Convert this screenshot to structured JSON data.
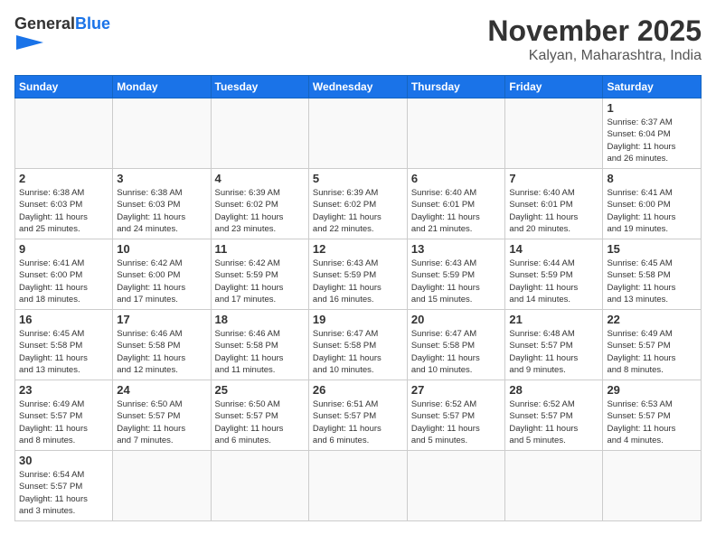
{
  "logo": {
    "text_general": "General",
    "text_blue": "Blue"
  },
  "title": "November 2025",
  "location": "Kalyan, Maharashtra, India",
  "days_of_week": [
    "Sunday",
    "Monday",
    "Tuesday",
    "Wednesday",
    "Thursday",
    "Friday",
    "Saturday"
  ],
  "weeks": [
    [
      {
        "day": "",
        "info": ""
      },
      {
        "day": "",
        "info": ""
      },
      {
        "day": "",
        "info": ""
      },
      {
        "day": "",
        "info": ""
      },
      {
        "day": "",
        "info": ""
      },
      {
        "day": "",
        "info": ""
      },
      {
        "day": "1",
        "info": "Sunrise: 6:37 AM\nSunset: 6:04 PM\nDaylight: 11 hours\nand 26 minutes."
      }
    ],
    [
      {
        "day": "2",
        "info": "Sunrise: 6:38 AM\nSunset: 6:03 PM\nDaylight: 11 hours\nand 25 minutes."
      },
      {
        "day": "3",
        "info": "Sunrise: 6:38 AM\nSunset: 6:03 PM\nDaylight: 11 hours\nand 24 minutes."
      },
      {
        "day": "4",
        "info": "Sunrise: 6:39 AM\nSunset: 6:02 PM\nDaylight: 11 hours\nand 23 minutes."
      },
      {
        "day": "5",
        "info": "Sunrise: 6:39 AM\nSunset: 6:02 PM\nDaylight: 11 hours\nand 22 minutes."
      },
      {
        "day": "6",
        "info": "Sunrise: 6:40 AM\nSunset: 6:01 PM\nDaylight: 11 hours\nand 21 minutes."
      },
      {
        "day": "7",
        "info": "Sunrise: 6:40 AM\nSunset: 6:01 PM\nDaylight: 11 hours\nand 20 minutes."
      },
      {
        "day": "8",
        "info": "Sunrise: 6:41 AM\nSunset: 6:00 PM\nDaylight: 11 hours\nand 19 minutes."
      }
    ],
    [
      {
        "day": "9",
        "info": "Sunrise: 6:41 AM\nSunset: 6:00 PM\nDaylight: 11 hours\nand 18 minutes."
      },
      {
        "day": "10",
        "info": "Sunrise: 6:42 AM\nSunset: 6:00 PM\nDaylight: 11 hours\nand 17 minutes."
      },
      {
        "day": "11",
        "info": "Sunrise: 6:42 AM\nSunset: 5:59 PM\nDaylight: 11 hours\nand 17 minutes."
      },
      {
        "day": "12",
        "info": "Sunrise: 6:43 AM\nSunset: 5:59 PM\nDaylight: 11 hours\nand 16 minutes."
      },
      {
        "day": "13",
        "info": "Sunrise: 6:43 AM\nSunset: 5:59 PM\nDaylight: 11 hours\nand 15 minutes."
      },
      {
        "day": "14",
        "info": "Sunrise: 6:44 AM\nSunset: 5:59 PM\nDaylight: 11 hours\nand 14 minutes."
      },
      {
        "day": "15",
        "info": "Sunrise: 6:45 AM\nSunset: 5:58 PM\nDaylight: 11 hours\nand 13 minutes."
      }
    ],
    [
      {
        "day": "16",
        "info": "Sunrise: 6:45 AM\nSunset: 5:58 PM\nDaylight: 11 hours\nand 13 minutes."
      },
      {
        "day": "17",
        "info": "Sunrise: 6:46 AM\nSunset: 5:58 PM\nDaylight: 11 hours\nand 12 minutes."
      },
      {
        "day": "18",
        "info": "Sunrise: 6:46 AM\nSunset: 5:58 PM\nDaylight: 11 hours\nand 11 minutes."
      },
      {
        "day": "19",
        "info": "Sunrise: 6:47 AM\nSunset: 5:58 PM\nDaylight: 11 hours\nand 10 minutes."
      },
      {
        "day": "20",
        "info": "Sunrise: 6:47 AM\nSunset: 5:58 PM\nDaylight: 11 hours\nand 10 minutes."
      },
      {
        "day": "21",
        "info": "Sunrise: 6:48 AM\nSunset: 5:57 PM\nDaylight: 11 hours\nand 9 minutes."
      },
      {
        "day": "22",
        "info": "Sunrise: 6:49 AM\nSunset: 5:57 PM\nDaylight: 11 hours\nand 8 minutes."
      }
    ],
    [
      {
        "day": "23",
        "info": "Sunrise: 6:49 AM\nSunset: 5:57 PM\nDaylight: 11 hours\nand 8 minutes."
      },
      {
        "day": "24",
        "info": "Sunrise: 6:50 AM\nSunset: 5:57 PM\nDaylight: 11 hours\nand 7 minutes."
      },
      {
        "day": "25",
        "info": "Sunrise: 6:50 AM\nSunset: 5:57 PM\nDaylight: 11 hours\nand 6 minutes."
      },
      {
        "day": "26",
        "info": "Sunrise: 6:51 AM\nSunset: 5:57 PM\nDaylight: 11 hours\nand 6 minutes."
      },
      {
        "day": "27",
        "info": "Sunrise: 6:52 AM\nSunset: 5:57 PM\nDaylight: 11 hours\nand 5 minutes."
      },
      {
        "day": "28",
        "info": "Sunrise: 6:52 AM\nSunset: 5:57 PM\nDaylight: 11 hours\nand 5 minutes."
      },
      {
        "day": "29",
        "info": "Sunrise: 6:53 AM\nSunset: 5:57 PM\nDaylight: 11 hours\nand 4 minutes."
      }
    ],
    [
      {
        "day": "30",
        "info": "Sunrise: 6:54 AM\nSunset: 5:57 PM\nDaylight: 11 hours\nand 3 minutes."
      },
      {
        "day": "",
        "info": ""
      },
      {
        "day": "",
        "info": ""
      },
      {
        "day": "",
        "info": ""
      },
      {
        "day": "",
        "info": ""
      },
      {
        "day": "",
        "info": ""
      },
      {
        "day": "",
        "info": ""
      }
    ]
  ]
}
